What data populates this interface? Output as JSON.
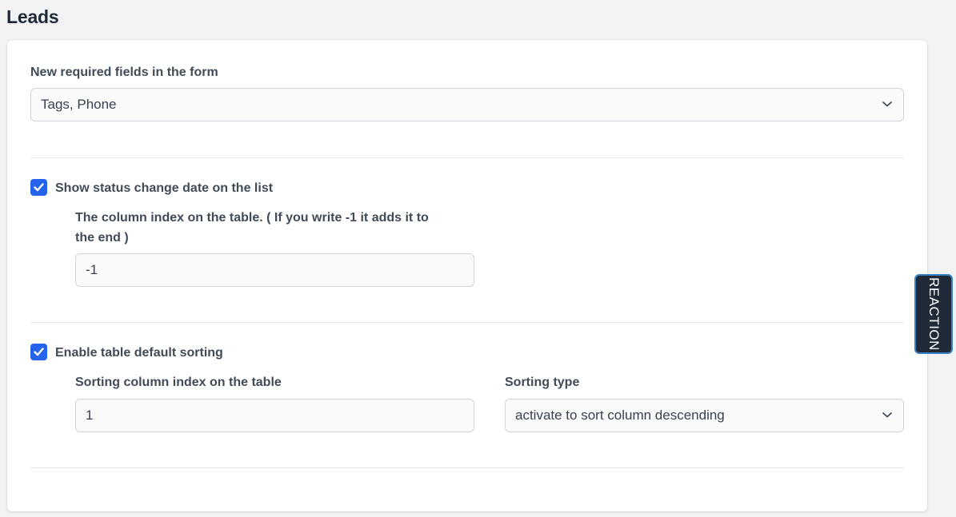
{
  "page": {
    "title": "Leads"
  },
  "required_fields": {
    "label": "New required fields in the form",
    "value": "Tags, Phone"
  },
  "status_change": {
    "checkbox_label": "Show status change date on the list",
    "checked": true,
    "column_index_label_line1": "The column index on the table. ( If you write -1 it adds it to",
    "column_index_label_line2": "the end )",
    "column_index_value": "-1"
  },
  "default_sorting": {
    "checkbox_label": "Enable table default sorting",
    "checked": true,
    "column_index_label": "Sorting column index on the table",
    "column_index_value": "1",
    "sorting_type_label": "Sorting type",
    "sorting_type_value": "activate to sort column descending"
  },
  "reaction_tab": {
    "label": "REACTION"
  },
  "colors": {
    "accent": "#2563eb",
    "page_background": "#f3f3f4",
    "card_background": "#ffffff",
    "reaction_tab_background": "#1f2937"
  },
  "icons": {
    "dropdown": "chevron-down-icon",
    "checkbox": "checkmark-icon"
  }
}
